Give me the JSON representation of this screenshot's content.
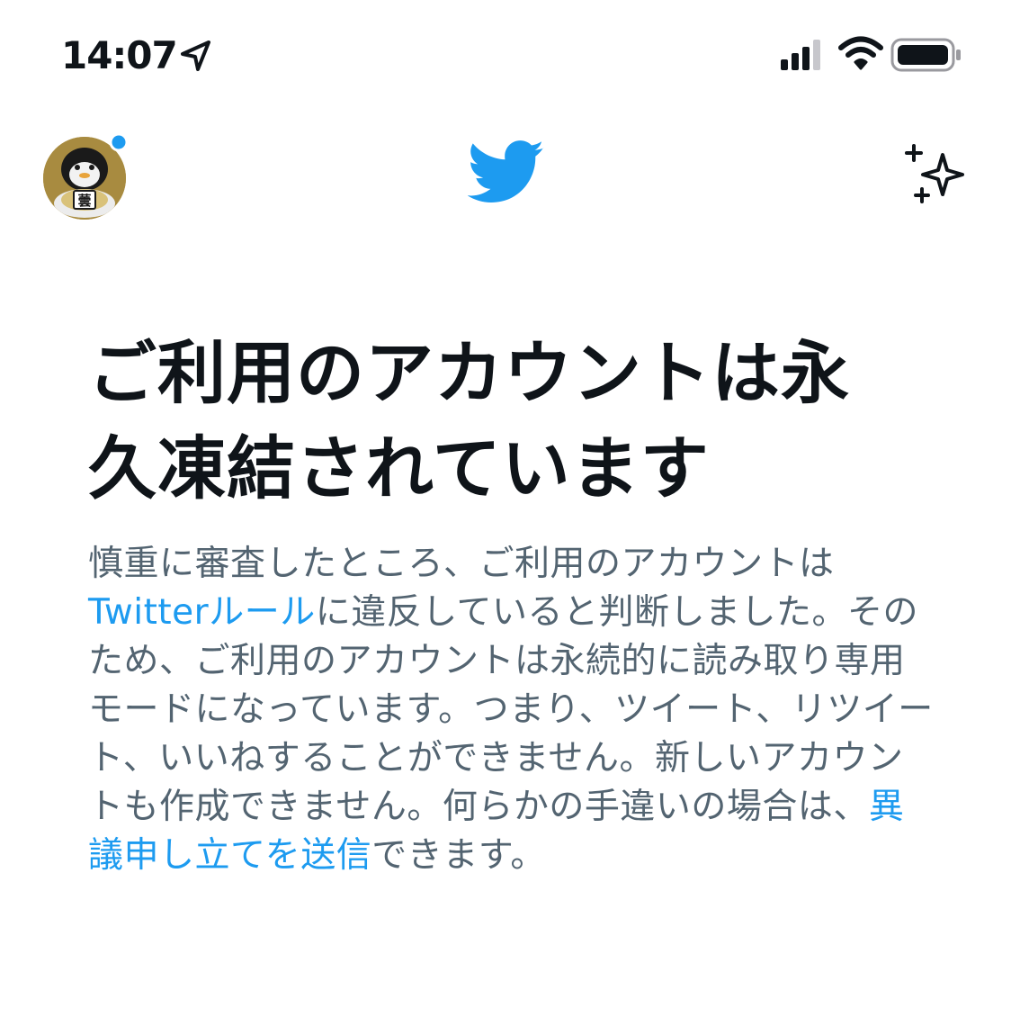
{
  "status_bar": {
    "time": "14:07",
    "icons": [
      "location-arrow-icon",
      "cellular-signal-icon",
      "wifi-icon",
      "battery-icon"
    ]
  },
  "nav": {
    "avatar_badge_color": "#1d9bf0",
    "logo_icon": "twitter-bird-icon",
    "right_icon": "sparkle-icon"
  },
  "main": {
    "title": "ご利用のアカウントは永久凍結されています",
    "body_part1": "慎重に審査したところ、ご利用のアカウントは",
    "rules_link": "Twitterルール",
    "body_part2": "に違反していると判断しました。そのため、ご利用のアカウントは永続的に読み取り専用モードになっています。つまり、ツイート、リツイート、いいねすることができません。新しいアカウントも作成できません。何らかの手違いの場合は、",
    "appeal_link": "異議申し立てを送信",
    "body_part3": "できます。"
  },
  "colors": {
    "accent": "#1d9bf0",
    "title": "#0f1419",
    "body": "#536471"
  }
}
